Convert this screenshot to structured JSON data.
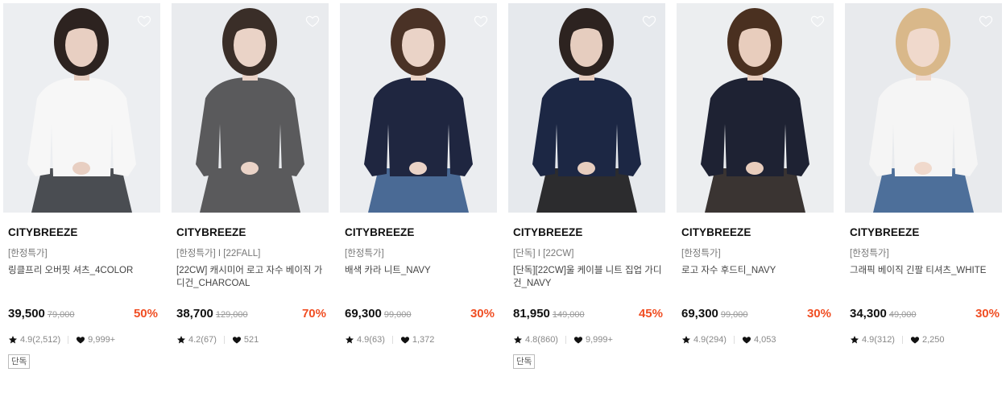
{
  "products": [
    {
      "brand": "CITYBREEZE",
      "tag": "[한정특가]",
      "name": "링클프리 오버핏 셔츠_4COLOR",
      "price": "39,500",
      "original_price": "79,000",
      "discount": "50%",
      "rating": "4.9(2,512)",
      "likes": "9,999+",
      "badge": "단독",
      "image": {
        "bg": "#eceef1",
        "top": "#f7f7f7",
        "bottom": "#4a4d52",
        "hair": "#2d2320",
        "skin": "#e8cfc2",
        "icon": "model-white-shirt-image"
      }
    },
    {
      "brand": "CITYBREEZE",
      "tag": "[한정특가] I [22FALL]",
      "name": "[22CW] 캐시미어 로고 자수 베이직 가디건_CHARCOAL",
      "price": "38,700",
      "original_price": "129,000",
      "discount": "70%",
      "rating": "4.2(67)",
      "likes": "521",
      "badge": "",
      "image": {
        "bg": "#e9ebee",
        "top": "#5a5a5c",
        "bottom": "#5a5a5c",
        "hair": "#3a2e28",
        "skin": "#ead3c7",
        "icon": "model-charcoal-cardigan-image"
      }
    },
    {
      "brand": "CITYBREEZE",
      "tag": "[한정특가]",
      "name": "배색 카라 니트_NAVY",
      "price": "69,300",
      "original_price": "99,000",
      "discount": "30%",
      "rating": "4.9(63)",
      "likes": "1,372",
      "badge": "",
      "image": {
        "bg": "#ebedf0",
        "top": "#1f2640",
        "bottom": "#4a6a95",
        "hair": "#4a3226",
        "skin": "#ead3c7",
        "icon": "model-navy-knit-image"
      }
    },
    {
      "brand": "CITYBREEZE",
      "tag": "[단독] I [22CW]",
      "name": "[단독][22CW]울 케이블 니트 집업 가디건_NAVY",
      "price": "81,950",
      "original_price": "149,000",
      "discount": "45%",
      "rating": "4.8(860)",
      "likes": "9,999+",
      "badge": "단독",
      "image": {
        "bg": "#e6e9ed",
        "top": "#1c2744",
        "bottom": "#2c2c2e",
        "hair": "#2d2320",
        "skin": "#e6cdbf",
        "icon": "model-navy-cable-zipup-image"
      }
    },
    {
      "brand": "CITYBREEZE",
      "tag": "[한정특가]",
      "name": "로고 자수 후드티_NAVY",
      "price": "69,300",
      "original_price": "99,000",
      "discount": "30%",
      "rating": "4.9(294)",
      "likes": "4,053",
      "badge": "",
      "image": {
        "bg": "#eceef0",
        "top": "#1e2233",
        "bottom": "#3a3432",
        "hair": "#4a3020",
        "skin": "#e8cdbd",
        "icon": "model-navy-hoodie-image"
      }
    },
    {
      "brand": "CITYBREEZE",
      "tag": "[한정특가]",
      "name": "그래픽 베이직 긴팔 티셔츠_WHITE",
      "price": "34,300",
      "original_price": "49,000",
      "discount": "30%",
      "rating": "4.9(312)",
      "likes": "2,250",
      "badge": "",
      "image": {
        "bg": "#e8eaed",
        "top": "#f5f5f5",
        "bottom": "#4d6f9a",
        "hair": "#d9b88a",
        "skin": "#f0d9cc",
        "icon": "model-white-graphic-tee-image"
      }
    }
  ],
  "colors": {
    "discount": "#f04e23",
    "text": "#222222",
    "muted": "#888888"
  }
}
